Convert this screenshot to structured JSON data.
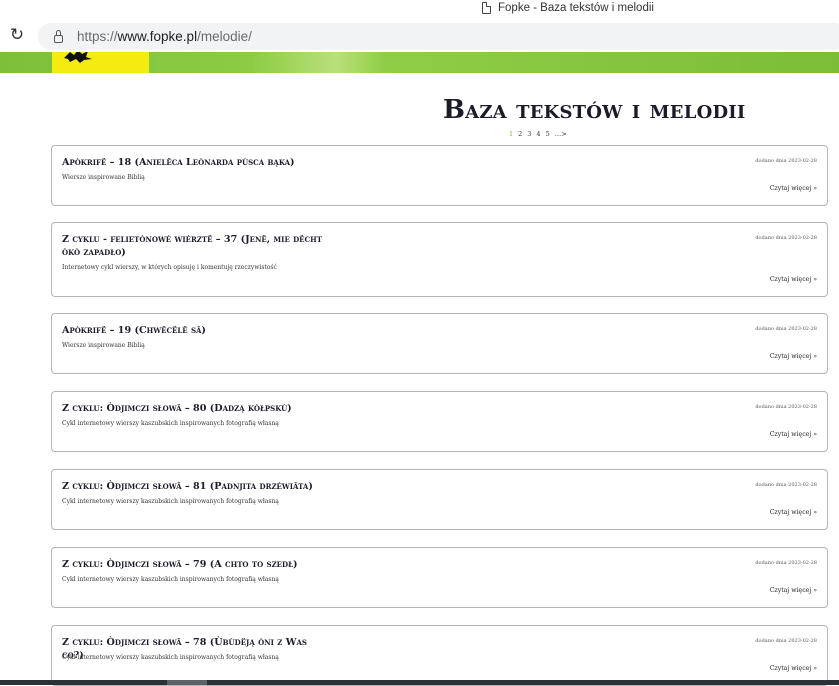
{
  "browser": {
    "tab_title": "Fopke - Baza tekstów i melodii",
    "url_scheme": "https://",
    "url_host": "www.fopke.pl",
    "url_path": "/melodie/"
  },
  "page": {
    "title": "Baza tekstów i melodii",
    "pagination": [
      "1",
      "2",
      "3",
      "4",
      "5",
      "…>"
    ],
    "current_page": "1"
  },
  "posts": [
    {
      "title": "Apòkrifë – 18 (Anielëca Leònarda pùsca bąka)",
      "subtitle": "Wiersze inspirowane Biblią",
      "date": "dodano dnia 2023-02-28",
      "more": "Czytaj więcej »"
    },
    {
      "title": "Z cyklu - felietònowé wiérztë – 37 (Jenë, mie dëcht òkò zapadło)",
      "subtitle": "Internetowy cykl wierszy, w których opisuję i komentuję rzeczywistość",
      "date": "dodano dnia 2023-02-28",
      "more": "Czytaj więcej »"
    },
    {
      "title": "Apòkrifë – 19 (Chwëcëlë sã)",
      "subtitle": "Wiersze inspirowane Biblią",
      "date": "dodano dnia 2023-02-28",
      "more": "Czytaj więcej »"
    },
    {
      "title": "Z cyklu: Òdjimczi słowã – 80 (Dadzą kòłpskù)",
      "subtitle": "Cykl internetowy wierszy kaszubskich inspirowanych fotografią własną",
      "date": "dodano dnia 2023-02-28",
      "more": "Czytaj więcej »"
    },
    {
      "title": "Z cyklu: Òdjimczi słowã – 81 (Padnjita drzéwiãta)",
      "subtitle": "Cykl internetowy wierszy kaszubskich inspirowanych fotografią własną",
      "date": "dodano dnia 2023-02-28",
      "more": "Czytaj więcej »"
    },
    {
      "title": "Z cyklu: Òdjimczi słowã – 79 (A chto to szedł)",
      "subtitle": "Cykl internetowy wierszy kaszubskich inspirowanych fotografią własną",
      "date": "dodano dnia 2023-02-28",
      "more": "Czytaj więcej »"
    },
    {
      "title": "Z cyklu: Òdjimczi słowã – 78 (Ùbùdëją òni z Was co?)",
      "subtitle": "Cykl internetowy wierszy kaszubskich inspirowanych fotografią własną",
      "date": "dodano dnia 2023-02-28",
      "more": "Czytaj więcej »"
    }
  ]
}
